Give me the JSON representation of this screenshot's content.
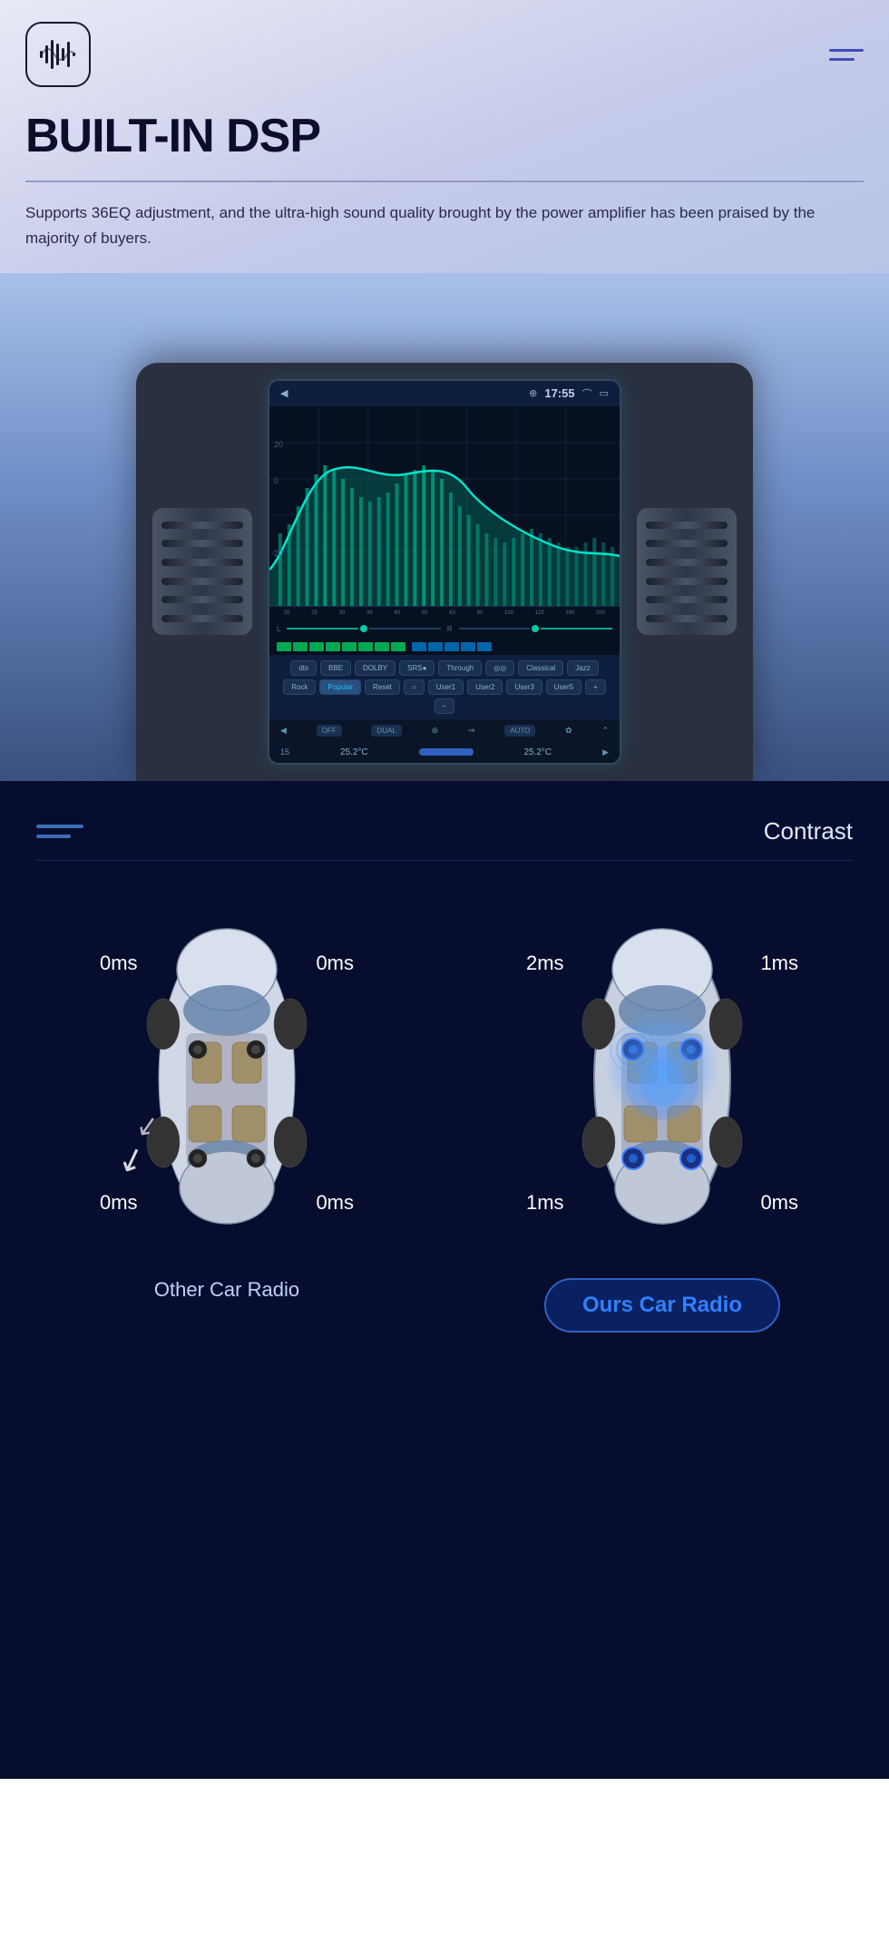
{
  "header": {
    "logo_aria": "sound-logo",
    "menu_aria": "hamburger-menu"
  },
  "top": {
    "title": "BUILT-IN DSP",
    "subtitle": "Supports 36EQ adjustment, and the ultra-high sound quality brought by the power amplifier has been praised by the majority of buyers.",
    "screen": {
      "time": "17:55",
      "temp_left": "25.2°C",
      "temp_right": "25.2°C",
      "mode": "AUTO",
      "fan": "DUAL",
      "eq_presets": [
        "dts",
        "BBE",
        "DOLBY",
        "SRS",
        "Through",
        "Classical",
        "Jazz",
        "Rock",
        "Popular",
        "Reset",
        "User1",
        "User2",
        "User3",
        "User5"
      ]
    }
  },
  "bottom": {
    "contrast_label": "Contrast",
    "other_car": {
      "label": "Other Car Radio",
      "timings": {
        "top_left": "0ms",
        "top_right": "0ms",
        "bottom_left": "0ms",
        "bottom_right": "0ms"
      }
    },
    "our_car": {
      "label": "Ours Car Radio",
      "timings": {
        "top_left": "2ms",
        "top_right": "1ms",
        "bottom_left": "1ms",
        "bottom_right": "0ms"
      }
    }
  }
}
